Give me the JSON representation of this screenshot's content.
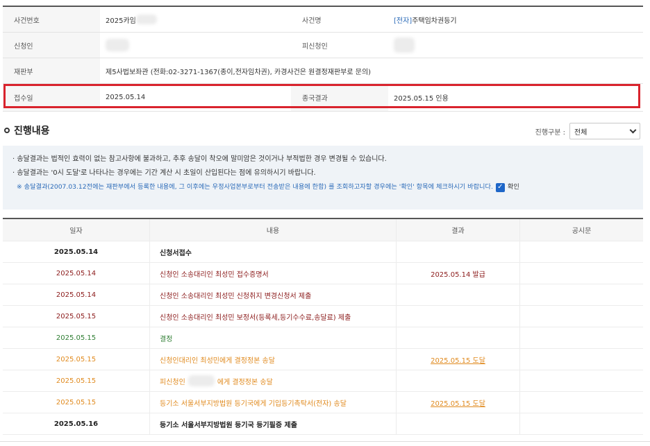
{
  "case_info": {
    "case_number_label": "사건번호",
    "case_number_value": "2025카임",
    "case_name_label": "사건명",
    "case_name_tag": "[전자]",
    "case_name_value": "주택임차권등기",
    "applicant_label": "신청인",
    "respondent_label": "피신청인",
    "court_label": "재판부",
    "court_value": "제5사법보좌관 (전화:02-3271-1367(종이,전자임차권), 카경사건은 원결정재판부로 문의)",
    "received_label": "접수일",
    "received_value": "2025.05.14",
    "result_label": "종국결과",
    "result_value": "2025.05.15 인용"
  },
  "progress": {
    "title": "진행내용",
    "filter_label": "진행구분 :",
    "filter_value": "전체",
    "notice_1": "· 송달결과는 법적인 효력이 없는 참고사항에 불과하고, 추후 송달이 착오에 말미암은 것이거나 부적법한 경우 변경될 수 있습니다.",
    "notice_2": "· 송달결과는 '0시 도달'로 나타나는 경우에는 기간 계산 시 초일이 산입된다는 점에 유의하시기 바랍니다.",
    "notice_3": "※ 송달결과(2007.03.12전에는 재판부에서 등록한 내용에, 그 이후에는 우정사업본부로부터 전송받은 내용에 한함) 를 조회하고자할 경우에는 '확인' 항목에 체크하시기 바랍니다.",
    "confirm_label": "확인",
    "headers": [
      "일자",
      "내용",
      "결과",
      "공시문"
    ],
    "rows": [
      {
        "date": "2025.05.14",
        "content": "신청서접수",
        "result": "",
        "notice": "",
        "color": "#222222",
        "bold": true
      },
      {
        "date": "2025.05.14",
        "content": "신청인 소송대리인 최성민 접수증명서",
        "result": "2025.05.14 발급",
        "notice": "",
        "color": "#8b1a1a",
        "bold": false
      },
      {
        "date": "2025.05.14",
        "content": "신청인 소송대리인 최성민 신청취지 변경신청서 제출",
        "result": "",
        "notice": "",
        "color": "#8b1a1a",
        "bold": false
      },
      {
        "date": "2025.05.15",
        "content": "신청인 소송대리인 최성민 보정서(등록세,등기수수료,송달료) 제출",
        "result": "",
        "notice": "",
        "color": "#8b1a1a",
        "bold": false
      },
      {
        "date": "2025.05.15",
        "content": "결정",
        "result": "",
        "notice": "",
        "color": "#2e7d32",
        "bold": false
      },
      {
        "date": "2025.05.15",
        "content": "신청인대리인 최성민에게 결정정본 송달",
        "result": "2025.05.15 도달",
        "notice": "",
        "color": "#e08a1e",
        "bold": false
      },
      {
        "date": "2025.05.15",
        "content_pre": "피신청인",
        "content": "에게 결정정본 송달",
        "result": "",
        "notice": "",
        "color": "#e08a1e",
        "bold": false
      },
      {
        "date": "2025.05.15",
        "content": "등기소 서울서부지방법원 등기국에게 기입등기촉탁서(전자) 송달",
        "result": "2025.05.15 도달",
        "notice": "",
        "color": "#e08a1e",
        "bold": false
      },
      {
        "date": "2025.05.16",
        "content": "등기소 서울서부지방법원 등기국 등기필증 제출",
        "result": "",
        "notice": "",
        "color": "#222222",
        "bold": true
      }
    ]
  }
}
